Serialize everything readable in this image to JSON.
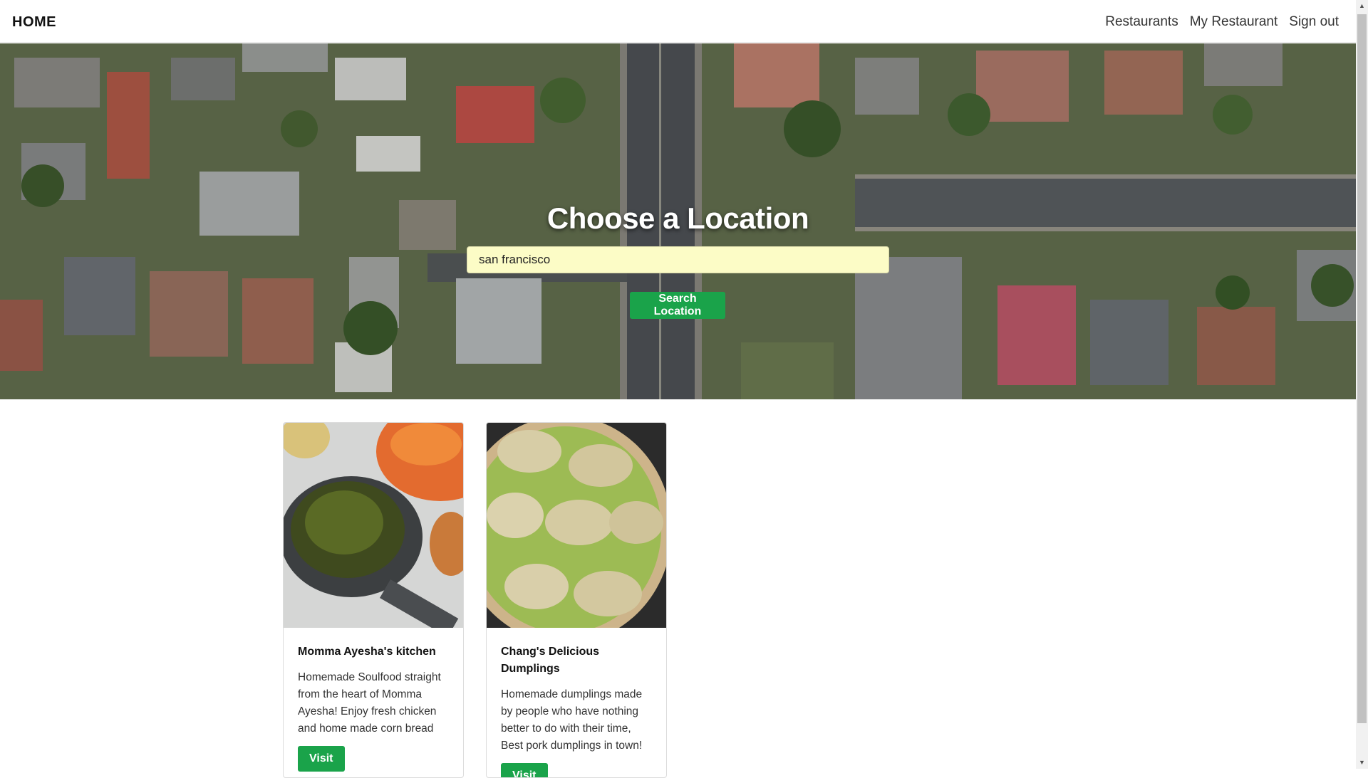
{
  "navbar": {
    "brand": "HOME",
    "links": [
      {
        "label": "Restaurants"
      },
      {
        "label": "My Restaurant"
      },
      {
        "label": "Sign out"
      }
    ]
  },
  "hero": {
    "title": "Choose a Location",
    "search_value": "san francisco",
    "search_button": "Search Location"
  },
  "restaurants": [
    {
      "name": "Momma Ayesha's kitchen",
      "description": "Homemade Soulfood straight from the heart of Momma Ayesha! Enjoy fresh chicken and home made corn bread",
      "button": "Visit"
    },
    {
      "name": "Chang's Delicious Dumplings",
      "description": "Homemade dumplings made by people who have nothing better to do with their time, Best pork dumplings in town!",
      "button": "Visit"
    }
  ],
  "colors": {
    "accent": "#1aa34a",
    "input_bg": "#fcfcc6"
  }
}
